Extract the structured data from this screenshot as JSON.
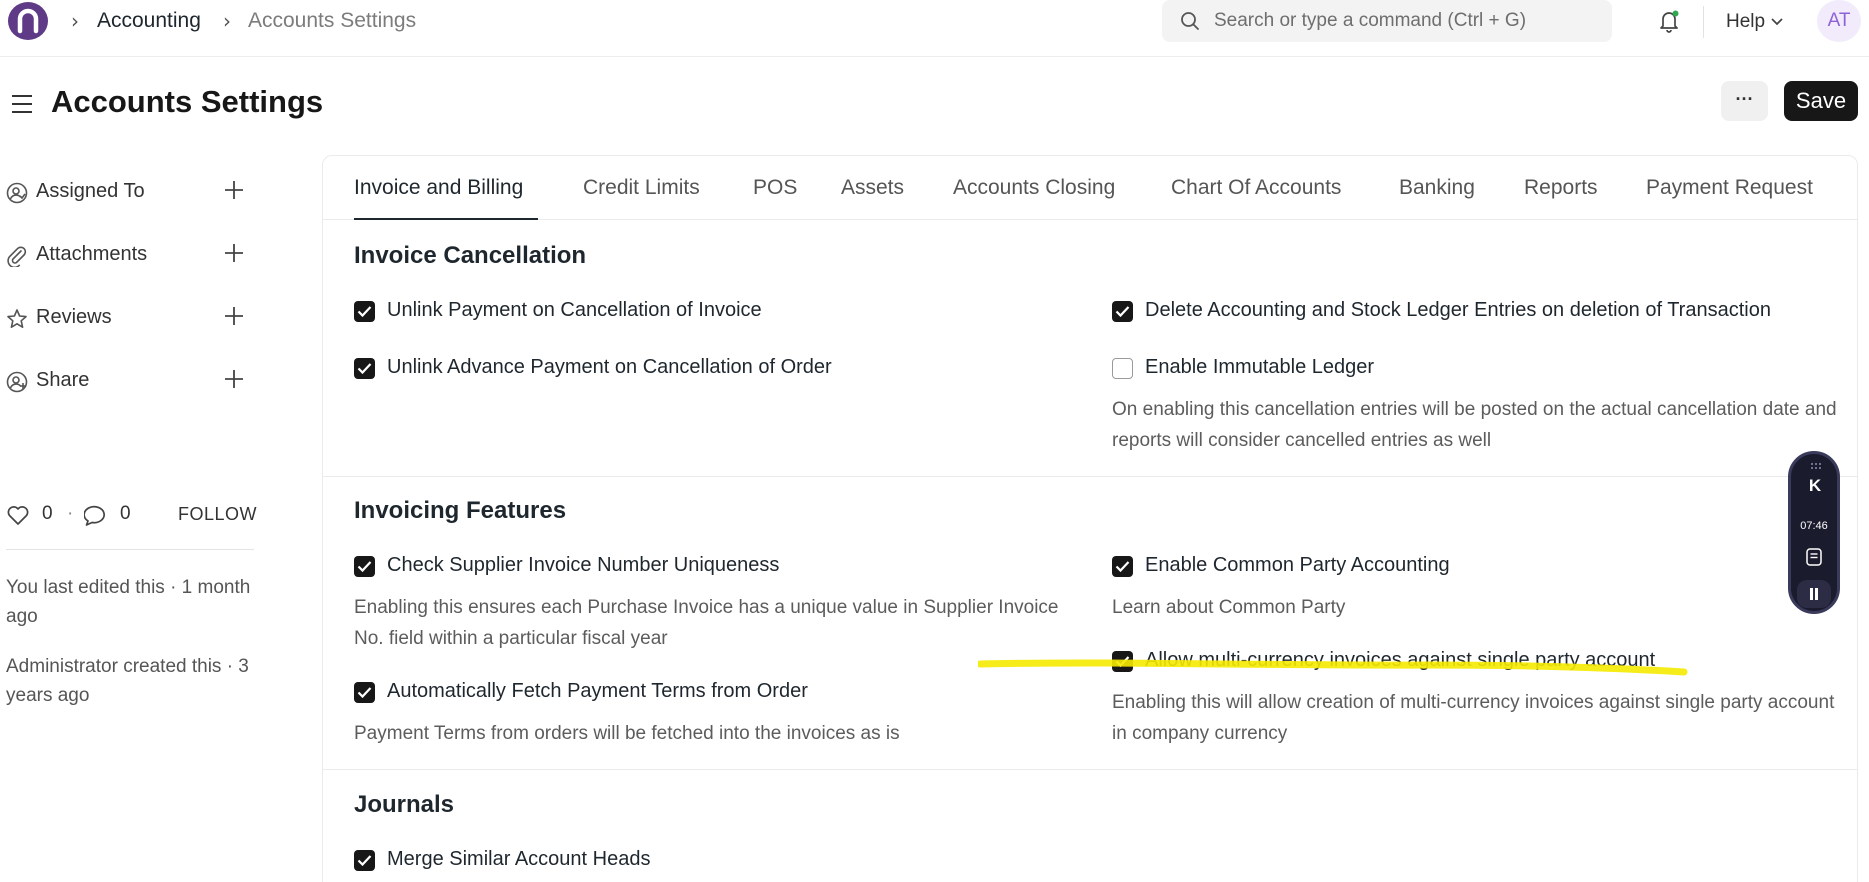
{
  "nav": {
    "breadcrumbs": [
      "Accounting",
      "Accounts Settings"
    ],
    "search_placeholder": "Search or type a command (Ctrl + G)",
    "help_label": "Help",
    "avatar_initials": "AT"
  },
  "page": {
    "title": "Accounts Settings",
    "more_label": "···",
    "save_label": "Save"
  },
  "sidebar": {
    "items": [
      {
        "label": "Assigned To",
        "icon": "user-assign-icon"
      },
      {
        "label": "Attachments",
        "icon": "paperclip-icon"
      },
      {
        "label": "Reviews",
        "icon": "star-icon"
      },
      {
        "label": "Share",
        "icon": "share-user-icon"
      }
    ],
    "likes": "0",
    "comments": "0",
    "follow_label": "FOLLOW",
    "edited_note": "You last edited this · 1 month ago",
    "created_note": "Administrator created this · 3 years ago"
  },
  "tabs": [
    "Invoice and Billing",
    "Credit Limits",
    "POS",
    "Assets",
    "Accounts Closing",
    "Chart Of Accounts",
    "Banking",
    "Reports",
    "Payment Request"
  ],
  "sections": {
    "cancellation": {
      "title": "Invoice Cancellation",
      "unlink_payment": "Unlink Payment on Cancellation of Invoice",
      "unlink_advance": "Unlink Advance Payment on Cancellation of Order",
      "delete_ledger": "Delete Accounting and Stock Ledger Entries on deletion of Transaction",
      "immutable_ledger": "Enable Immutable Ledger",
      "immutable_desc": "On enabling this cancellation entries will be posted on the actual cancellation date and reports will consider cancelled entries as well"
    },
    "features": {
      "title": "Invoicing Features",
      "supplier_unique": "Check Supplier Invoice Number Uniqueness",
      "supplier_desc": "Enabling this ensures each Purchase Invoice has a unique value in Supplier Invoice No. field within a particular fiscal year",
      "fetch_terms": "Automatically Fetch Payment Terms from Order",
      "fetch_desc": "Payment Terms from orders will be fetched into the invoices as is",
      "common_party": "Enable Common Party Accounting",
      "common_desc": "Learn about Common Party",
      "multi_currency": "Allow multi-currency invoices against single party account",
      "multi_desc": "Enabling this will allow creation of multi-currency invoices against single party account in company currency"
    },
    "journals": {
      "title": "Journals",
      "merge_heads": "Merge Similar Account Heads"
    }
  },
  "recorder": {
    "time": "07:46"
  },
  "colors": {
    "brand": "#5e3a87",
    "checkbox": "#171717",
    "highlight": "#f5ea00"
  }
}
